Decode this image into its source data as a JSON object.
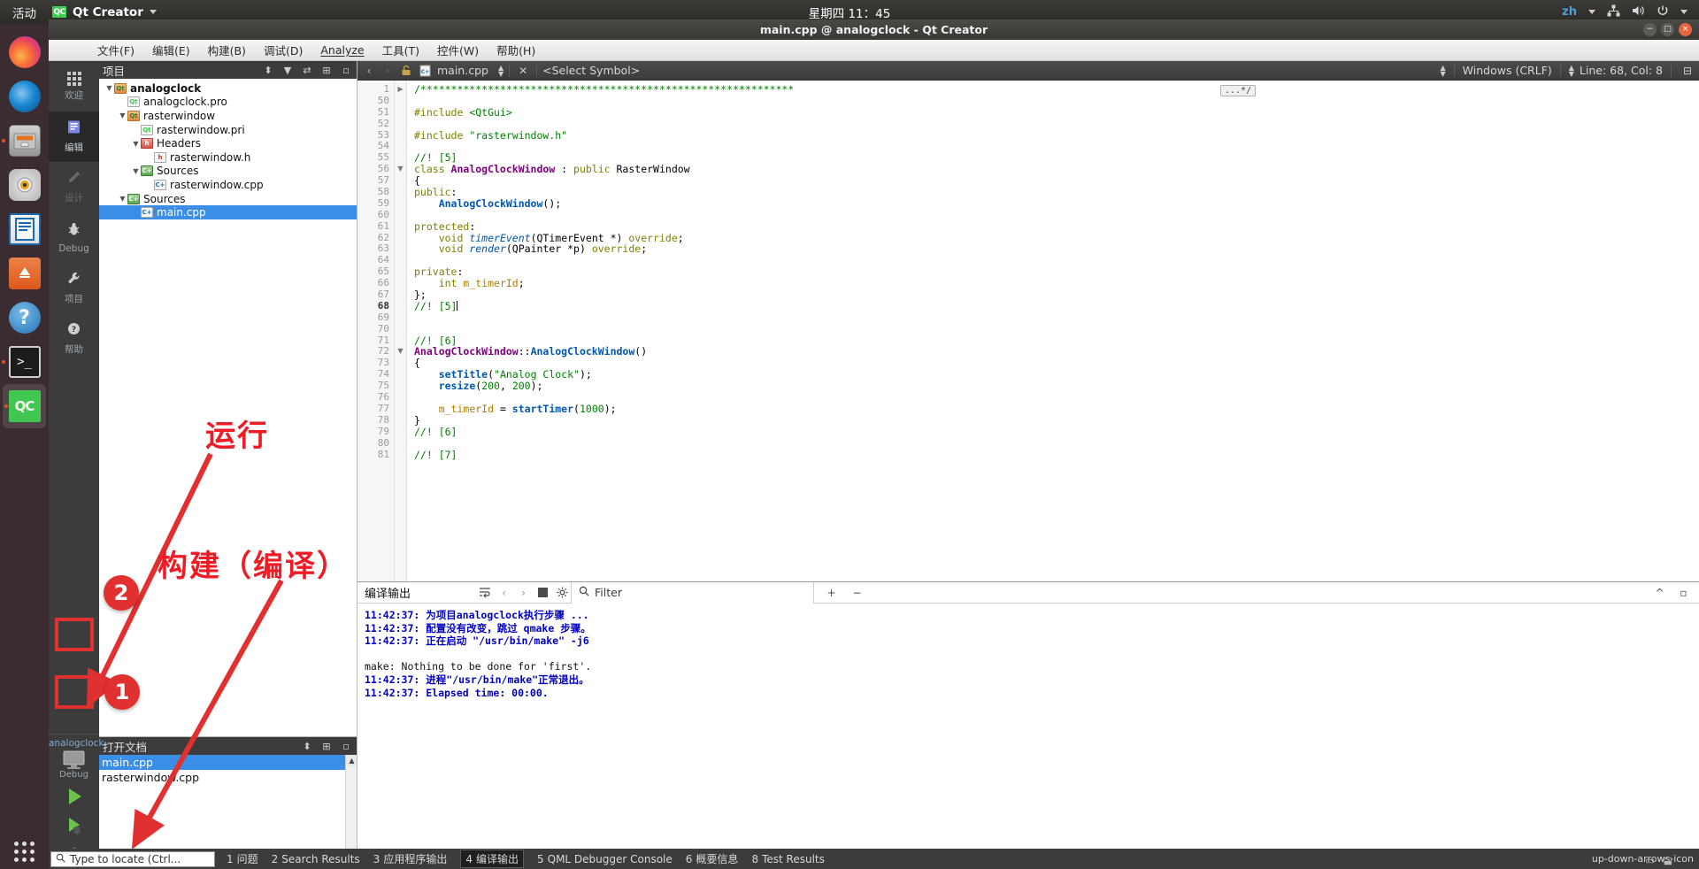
{
  "gnome": {
    "activities": "活动",
    "app_name": "Qt Creator",
    "app_badge": "QC",
    "clock": "星期四 11：45",
    "keyboard": "zh",
    "icons": {
      "network": "network-icon",
      "volume": "volume-icon",
      "power": "power-icon"
    }
  },
  "dock": {
    "items": [
      {
        "name": "firefox",
        "label": "Firefox",
        "running": false
      },
      {
        "name": "thunderbird",
        "label": "Thunderbird",
        "running": false
      },
      {
        "name": "files",
        "label": "Files",
        "running": true
      },
      {
        "name": "rhythmbox",
        "label": "Rhythmbox",
        "running": false
      },
      {
        "name": "libreoffice-writer",
        "label": "LibreOffice Writer",
        "running": false
      },
      {
        "name": "ubuntu-software",
        "label": "Ubuntu Software",
        "running": false
      },
      {
        "name": "help",
        "label": "Help",
        "running": false
      },
      {
        "name": "terminal",
        "label": "Terminal",
        "running": true
      },
      {
        "name": "qtcreator",
        "label": "QC",
        "running": true,
        "active": true
      }
    ],
    "show_apps": "show-applications"
  },
  "window": {
    "title": "main.cpp @ analogclock - Qt Creator",
    "buttons": {
      "minimize": "−",
      "maximize": "□",
      "close": "×"
    }
  },
  "menubar": [
    {
      "label": "文件(F)",
      "mnemonic": "F"
    },
    {
      "label": "编辑(E)",
      "mnemonic": "E"
    },
    {
      "label": "构建(B)",
      "mnemonic": "B"
    },
    {
      "label": "调试(D)",
      "mnemonic": "D"
    },
    {
      "label": "Analyze",
      "mnemonic": "A"
    },
    {
      "label": "工具(T)",
      "mnemonic": "T"
    },
    {
      "label": "控件(W)",
      "mnemonic": "W"
    },
    {
      "label": "帮助(H)",
      "mnemonic": "H"
    }
  ],
  "modebar": {
    "items": [
      {
        "label": "欢迎",
        "icon": "welcome-grid-icon",
        "state": "normal"
      },
      {
        "label": "编辑",
        "icon": "edit-document-icon",
        "state": "selected"
      },
      {
        "label": "设计",
        "icon": "design-pencil-icon",
        "state": "disabled"
      },
      {
        "label": "Debug",
        "icon": "debug-bug-icon",
        "state": "normal"
      },
      {
        "label": "项目",
        "icon": "projects-wrench-icon",
        "state": "normal"
      },
      {
        "label": "帮助",
        "icon": "help-question-icon",
        "state": "normal"
      }
    ],
    "kit": {
      "project": "analogclock",
      "build_config": "Debug",
      "icon": "desktop-kit-icon"
    },
    "run_button": "run-button",
    "debug_button": "start-debugging-button",
    "build_button": "build-project-button"
  },
  "project_panel": {
    "title": "项目",
    "toolbar_icons": [
      "sync-with-editor-icon",
      "filter-icon",
      "link-icon",
      "split-icon",
      "collapse-icon"
    ],
    "tree": [
      {
        "depth": 0,
        "label": "analogclock",
        "icon": "qt-project-icon",
        "expanded": true,
        "bold": true
      },
      {
        "depth": 1,
        "label": "analogclock.pro",
        "icon": "qt-pro-file-icon",
        "expanded": null
      },
      {
        "depth": 1,
        "label": "rasterwindow",
        "icon": "qt-project-icon",
        "expanded": true
      },
      {
        "depth": 2,
        "label": "rasterwindow.pri",
        "icon": "qt-pro-file-icon",
        "expanded": null
      },
      {
        "depth": 2,
        "label": "Headers",
        "icon": "headers-folder-icon",
        "expanded": true
      },
      {
        "depth": 3,
        "label": "rasterwindow.h",
        "icon": "header-file-icon",
        "expanded": null
      },
      {
        "depth": 2,
        "label": "Sources",
        "icon": "sources-folder-icon",
        "expanded": true
      },
      {
        "depth": 3,
        "label": "rasterwindow.cpp",
        "icon": "cpp-file-icon",
        "expanded": null
      },
      {
        "depth": 1,
        "label": "Sources",
        "icon": "sources-folder-icon",
        "expanded": true
      },
      {
        "depth": 2,
        "label": "main.cpp",
        "icon": "cpp-file-icon",
        "expanded": null,
        "selected": true
      }
    ]
  },
  "open_documents": {
    "title": "打开文档",
    "items": [
      {
        "label": "main.cpp",
        "selected": true
      },
      {
        "label": "rasterwindow.cpp",
        "selected": false
      }
    ]
  },
  "editor_toolbar": {
    "back": "◀",
    "forward": "▶",
    "lock_icon": "unlocked-icon",
    "file_name": "main.cpp",
    "file_icon": "cpp-file-icon",
    "close_icon": "×",
    "symbol_selector": "<Select Symbol>",
    "line_ending": "Windows (CRLF)",
    "cursor_position": "Line: 68, Col: 8",
    "split_icon": "split-editor-icon"
  },
  "editor": {
    "fold_marker": "...*/",
    "lines": [
      {
        "num": "1",
        "fold": "▶",
        "current": false,
        "tokens": [
          {
            "t": "/*************************************************************",
            "c": "cm"
          }
        ]
      },
      {
        "num": "50",
        "fold": "",
        "current": false,
        "tokens": []
      },
      {
        "num": "51",
        "fold": "",
        "current": false,
        "tokens": [
          {
            "t": "#include ",
            "c": "k"
          },
          {
            "t": "<QtGui>",
            "c": "st"
          }
        ]
      },
      {
        "num": "52",
        "fold": "",
        "current": false,
        "tokens": []
      },
      {
        "num": "53",
        "fold": "",
        "current": false,
        "tokens": [
          {
            "t": "#include ",
            "c": "k"
          },
          {
            "t": "\"rasterwindow.h\"",
            "c": "st"
          }
        ]
      },
      {
        "num": "54",
        "fold": "",
        "current": false,
        "tokens": []
      },
      {
        "num": "55",
        "fold": "",
        "current": false,
        "tokens": [
          {
            "t": "//! [5]",
            "c": "cm"
          }
        ]
      },
      {
        "num": "56",
        "fold": "▼",
        "current": false,
        "tokens": [
          {
            "t": "class ",
            "c": "k"
          },
          {
            "t": "AnalogClockWindow",
            "c": "ty"
          },
          {
            "t": " : ",
            "c": "pl"
          },
          {
            "t": "public",
            "c": "k"
          },
          {
            "t": " RasterWindow",
            "c": "pl"
          }
        ]
      },
      {
        "num": "57",
        "fold": "",
        "current": false,
        "tokens": [
          {
            "t": "{",
            "c": "pl"
          }
        ]
      },
      {
        "num": "58",
        "fold": "",
        "current": false,
        "tokens": [
          {
            "t": "public",
            "c": "k"
          },
          {
            "t": ":",
            "c": "pl"
          }
        ]
      },
      {
        "num": "59",
        "fold": "",
        "current": false,
        "tokens": [
          {
            "t": "    ",
            "c": "pl"
          },
          {
            "t": "AnalogClockWindow",
            "c": "fn"
          },
          {
            "t": "();",
            "c": "pl"
          }
        ]
      },
      {
        "num": "60",
        "fold": "",
        "current": false,
        "tokens": []
      },
      {
        "num": "61",
        "fold": "",
        "current": false,
        "tokens": [
          {
            "t": "protected",
            "c": "k"
          },
          {
            "t": ":",
            "c": "pl"
          }
        ]
      },
      {
        "num": "62",
        "fold": "",
        "current": false,
        "tokens": [
          {
            "t": "    ",
            "c": "pl"
          },
          {
            "t": "void ",
            "c": "k"
          },
          {
            "t": "timerEvent",
            "c": "fni"
          },
          {
            "t": "(QTimerEvent *) ",
            "c": "pl"
          },
          {
            "t": "override",
            "c": "k"
          },
          {
            "t": ";",
            "c": "pl"
          }
        ]
      },
      {
        "num": "63",
        "fold": "",
        "current": false,
        "tokens": [
          {
            "t": "    ",
            "c": "pl"
          },
          {
            "t": "void ",
            "c": "k"
          },
          {
            "t": "render",
            "c": "fni"
          },
          {
            "t": "(QPainter *p) ",
            "c": "pl"
          },
          {
            "t": "override",
            "c": "k"
          },
          {
            "t": ";",
            "c": "pl"
          }
        ]
      },
      {
        "num": "64",
        "fold": "",
        "current": false,
        "tokens": []
      },
      {
        "num": "65",
        "fold": "",
        "current": false,
        "tokens": [
          {
            "t": "private",
            "c": "k"
          },
          {
            "t": ":",
            "c": "pl"
          }
        ]
      },
      {
        "num": "66",
        "fold": "",
        "current": false,
        "tokens": [
          {
            "t": "    ",
            "c": "pl"
          },
          {
            "t": "int ",
            "c": "k"
          },
          {
            "t": "m_timerId",
            "c": "nm"
          },
          {
            "t": ";",
            "c": "pl"
          }
        ]
      },
      {
        "num": "67",
        "fold": "",
        "current": false,
        "tokens": [
          {
            "t": "};",
            "c": "pl"
          }
        ]
      },
      {
        "num": "68",
        "fold": "",
        "current": true,
        "tokens": [
          {
            "t": "//! [5]",
            "c": "cm"
          }
        ],
        "caret": true
      },
      {
        "num": "69",
        "fold": "",
        "current": false,
        "tokens": []
      },
      {
        "num": "70",
        "fold": "",
        "current": false,
        "tokens": []
      },
      {
        "num": "71",
        "fold": "",
        "current": false,
        "tokens": [
          {
            "t": "//! [6]",
            "c": "cm"
          }
        ]
      },
      {
        "num": "72",
        "fold": "▼",
        "current": false,
        "tokens": [
          {
            "t": "AnalogClockWindow",
            "c": "ty"
          },
          {
            "t": "::",
            "c": "pl"
          },
          {
            "t": "AnalogClockWindow",
            "c": "fn"
          },
          {
            "t": "()",
            "c": "pl"
          }
        ]
      },
      {
        "num": "73",
        "fold": "",
        "current": false,
        "tokens": [
          {
            "t": "{",
            "c": "pl"
          }
        ]
      },
      {
        "num": "74",
        "fold": "",
        "current": false,
        "tokens": [
          {
            "t": "    ",
            "c": "pl"
          },
          {
            "t": "setTitle",
            "c": "fn"
          },
          {
            "t": "(",
            "c": "pl"
          },
          {
            "t": "\"Analog Clock\"",
            "c": "st"
          },
          {
            "t": ");",
            "c": "pl"
          }
        ]
      },
      {
        "num": "75",
        "fold": "",
        "current": false,
        "tokens": [
          {
            "t": "    ",
            "c": "pl"
          },
          {
            "t": "resize",
            "c": "fn"
          },
          {
            "t": "(",
            "c": "pl"
          },
          {
            "t": "200",
            "c": "st"
          },
          {
            "t": ", ",
            "c": "pl"
          },
          {
            "t": "200",
            "c": "st"
          },
          {
            "t": ");",
            "c": "pl"
          }
        ]
      },
      {
        "num": "76",
        "fold": "",
        "current": false,
        "tokens": []
      },
      {
        "num": "77",
        "fold": "",
        "current": false,
        "tokens": [
          {
            "t": "    ",
            "c": "pl"
          },
          {
            "t": "m_timerId",
            "c": "nm"
          },
          {
            "t": " = ",
            "c": "pl"
          },
          {
            "t": "startTimer",
            "c": "fn"
          },
          {
            "t": "(",
            "c": "pl"
          },
          {
            "t": "1000",
            "c": "st"
          },
          {
            "t": ");",
            "c": "pl"
          }
        ]
      },
      {
        "num": "78",
        "fold": "",
        "current": false,
        "tokens": [
          {
            "t": "}",
            "c": "pl"
          }
        ]
      },
      {
        "num": "79",
        "fold": "",
        "current": false,
        "tokens": [
          {
            "t": "//! [6]",
            "c": "cm"
          }
        ]
      },
      {
        "num": "80",
        "fold": "",
        "current": false,
        "tokens": []
      },
      {
        "num": "81",
        "fold": "",
        "current": false,
        "tokens": [
          {
            "t": "//! [7]",
            "c": "cm"
          }
        ]
      }
    ]
  },
  "output_pane": {
    "title": "编译输出",
    "toolbar_icons": [
      "wrap-lines-icon",
      "prev-item-icon",
      "next-item-icon",
      "stop-icon",
      "settings-gear-icon"
    ],
    "filter_placeholder": "Filter",
    "filter_icon": "search-icon",
    "zoom_in": "+",
    "zoom_out": "−",
    "maximize_icon": "^",
    "float_icon": "▫",
    "lines": [
      {
        "text": "11:42:37: 为项目analogclock执行步骤 ...",
        "style": "blue"
      },
      {
        "text": "11:42:37: 配置没有改变，跳过 qmake 步骤。",
        "style": "blue"
      },
      {
        "text": "11:42:37: 正在启动 \"/usr/bin/make\" -j6",
        "style": "blue"
      },
      {
        "text": "",
        "style": "blue"
      },
      {
        "text": "make: Nothing to be done for 'first'.",
        "style": "black"
      },
      {
        "text": "11:42:37: 进程\"/usr/bin/make\"正常退出。",
        "style": "blue"
      },
      {
        "text": "11:42:37: Elapsed time: 00:00.",
        "style": "blue"
      }
    ]
  },
  "statusbar": {
    "locator_placeholder": "Type to locate (Ctrl...",
    "locator_icon": "search-icon",
    "items": [
      {
        "num": "1",
        "label": "问题",
        "selected": false
      },
      {
        "num": "2",
        "label": "Search Results",
        "selected": false
      },
      {
        "num": "3",
        "label": "应用程序输出",
        "selected": false
      },
      {
        "num": "4",
        "label": "编译输出",
        "selected": true
      },
      {
        "num": "5",
        "label": "QML Debugger Console",
        "selected": false
      },
      {
        "num": "6",
        "label": "概要信息",
        "selected": false
      },
      {
        "num": "8",
        "label": "Test Results",
        "selected": false
      }
    ],
    "updown_icon": "up-down-arrows-icon",
    "right_icons": [
      "minimize-output-icon",
      "expand-output-icon"
    ]
  },
  "annotations": {
    "run_label": "运行",
    "build_label": "构建（编译）",
    "badge_1": "1",
    "badge_2": "2",
    "color": "#ee1c25"
  }
}
